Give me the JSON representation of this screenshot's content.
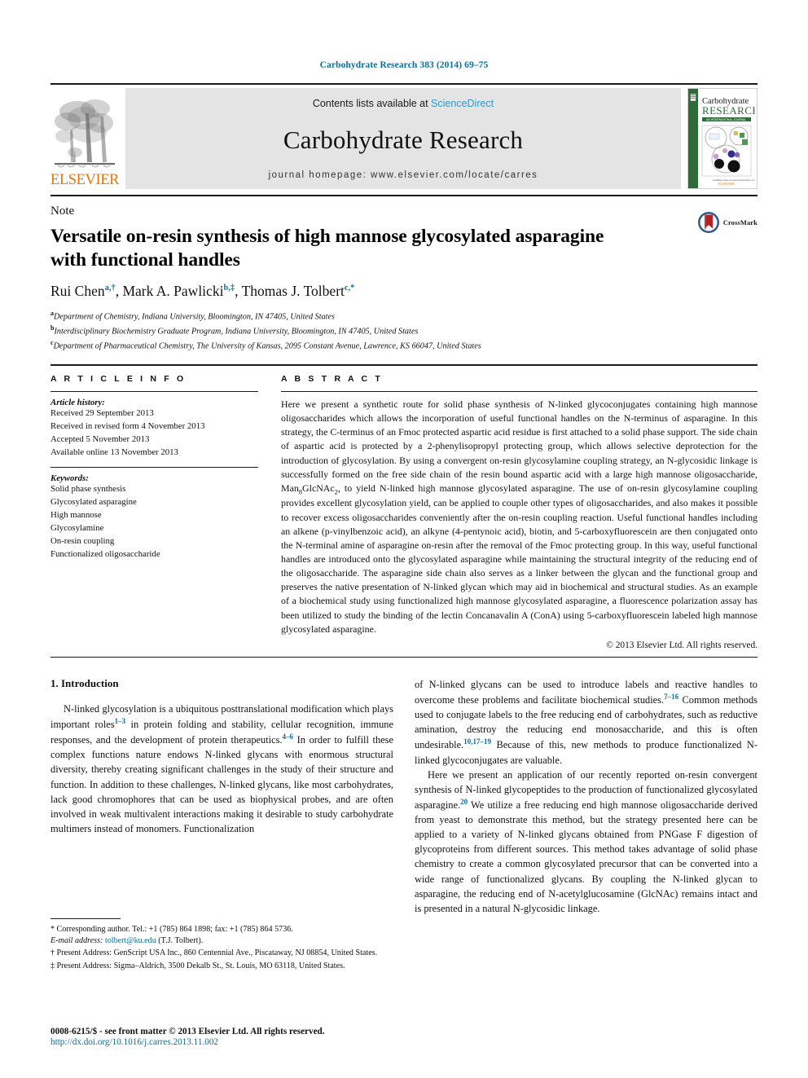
{
  "running_head": "Carbohydrate Research 383 (2014) 69–75",
  "masthead": {
    "publisher_logo_word": "ELSEVIER",
    "contents_prefix": "Contents lists available at ",
    "contents_link": "ScienceDirect",
    "journal_title": "Carbohydrate Research",
    "homepage": "journal homepage: www.elsevier.com/locate/carres",
    "cover": {
      "title_line1": "Carbohydrate",
      "title_line2": "RESEARCH",
      "subtitle": "AN INTERNATIONAL JOURNAL",
      "footer": "ELSEVIER"
    }
  },
  "article": {
    "doc_type": "Note",
    "title": "Versatile on-resin synthesis of high mannose glycosylated asparagine with functional handles",
    "crossmark_label": "CrossMark",
    "authors": [
      {
        "name": "Rui Chen",
        "marks": "a,†"
      },
      {
        "name": "Mark A. Pawlicki",
        "marks": "b,‡"
      },
      {
        "name": "Thomas J. Tolbert",
        "marks": "c,*"
      }
    ],
    "affiliations": [
      {
        "mark": "a",
        "text": "Department of Chemistry, Indiana University, Bloomington, IN 47405, United States"
      },
      {
        "mark": "b",
        "text": "Interdisciplinary Biochemistry Graduate Program, Indiana University, Bloomington, IN 47405, United States"
      },
      {
        "mark": "c",
        "text": "Department of Pharmaceutical Chemistry, The University of Kansas, 2095 Constant Avenue, Lawrence, KS 66047, United States"
      }
    ]
  },
  "article_info": {
    "section_label": "A R T I C L E   I N F O",
    "history_label": "Article history:",
    "history": [
      "Received 29 September 2013",
      "Received in revised form 4 November 2013",
      "Accepted 5 November 2013",
      "Available online 13 November 2013"
    ],
    "keywords_label": "Keywords:",
    "keywords": [
      "Solid phase synthesis",
      "Glycosylated asparagine",
      "High mannose",
      "Glycosylamine",
      "On-resin coupling",
      "Functionalized oligosaccharide"
    ]
  },
  "abstract": {
    "section_label": "A B S T R A C T",
    "part1": "Here we present a synthetic route for solid phase synthesis of N-linked glycoconjugates containing high mannose oligosaccharides which allows the incorporation of useful functional handles on the N-terminus of asparagine. In this strategy, the C-terminus of an Fmoc protected aspartic acid residue is first attached to a solid phase support. The side chain of aspartic acid is protected by a 2-phenylisopropyl protecting group, which allows selective deprotection for the introduction of glycosylation. By using a convergent on-resin glycosylamine coupling strategy, an N-glycosidic linkage is successfully formed on the free side chain of the resin bound aspartic acid with a large high mannose oligosaccharide, Man",
    "sub1": "8",
    "part2": "GlcNAc",
    "sub2": "2",
    "part3": ", to yield N-linked high mannose glycosylated asparagine. The use of on-resin glycosylamine coupling provides excellent glycosylation yield, can be applied to couple other types of oligosaccharides, and also makes it possible to recover excess oligosaccharides conveniently after the on-resin coupling reaction. Useful functional handles including an alkene (p-vinylbenzoic acid), an alkyne (4-pentynoic acid), biotin, and 5-carboxyfluorescein are then conjugated onto the N-terminal amine of asparagine on-resin after the removal of the Fmoc protecting group. In this way, useful functional handles are introduced onto the glycosylated asparagine while maintaining the structural integrity of the reducing end of the oligosaccharide. The asparagine side chain also serves as a linker between the glycan and the functional group and preserves the native presentation of N-linked glycan which may aid in biochemical and structural studies. As an example of a biochemical study using functionalized high mannose glycosylated asparagine, a fluorescence polarization assay has been utilized to study the binding of the lectin Concanavalin A (ConA) using 5-carboxyfluorescein labeled high mannose glycosylated asparagine.",
    "copyright": "© 2013 Elsevier Ltd. All rights reserved."
  },
  "body": {
    "section_heading": "1. Introduction",
    "left_para1_a": "N-linked glycosylation is a ubiquitous posttranslational modification which plays important roles",
    "left_ref1": "1–3",
    "left_para1_b": " in protein folding and stability, cellular recognition, immune responses, and the development of protein therapeutics.",
    "left_ref2": "4–6",
    "left_para1_c": " In order to fulfill these complex functions nature endows N-linked glycans with enormous structural diversity, thereby creating significant challenges in the study of their structure and function. In addition to these challenges, N-linked glycans, like most carbohydrates, lack good chromophores that can be used as biophysical probes, and are often involved in weak multivalent interactions making it desirable to study carbohydrate multimers instead of monomers. Functionalization",
    "right_para1_a": "of N-linked glycans can be used to introduce labels and reactive handles to overcome these problems and facilitate biochemical studies.",
    "right_ref1": "7–16",
    "right_para1_b": " Common methods used to conjugate labels to the free reducing end of carbohydrates, such as reductive amination, destroy the reducing end monosaccharide, and this is often undesirable.",
    "right_ref2": "10,17–19",
    "right_para1_c": " Because of this, new methods to produce functionalized N-linked glycoconjugates are valuable.",
    "right_para2_a": "Here we present an application of our recently reported on-resin convergent synthesis of N-linked glycopeptides to the production of functionalized glycosylated asparagine.",
    "right_ref3": "20",
    "right_para2_b": " We utilize a free reducing end high mannose oligosaccharide derived from yeast to demonstrate this method, but the strategy presented here can be applied to a variety of N-linked glycans obtained from PNGase F digestion of glycoproteins from different sources. This method takes advantage of solid phase chemistry to create a common glycosylated precursor that can be converted into a wide range of functionalized glycans. By coupling the N-linked glycan to asparagine, the reducing end of N-acetylglucosamine (GlcNAc) remains intact and is presented in a natural N-glycosidic linkage."
  },
  "footnotes": [
    {
      "mark": "*",
      "text": "Corresponding author. Tel.: +1 (785) 864 1898; fax: +1 (785) 864 5736.",
      "email_label": "E-mail address:",
      "email": "tolbert@ku.edu",
      "email_suffix": " (T.J. Tolbert)."
    },
    {
      "mark": "†",
      "text": "Present Address: GenScript USA Inc., 860 Centennial Ave., Piscataway, NJ 08854, United States."
    },
    {
      "mark": "‡",
      "text": "Present Address: Sigma–Aldrich, 3500 Dekalb St., St. Louis, MO 63118, United States."
    }
  ],
  "bottom": {
    "issn_line": "0008-6215/$ - see front matter © 2013 Elsevier Ltd. All rights reserved.",
    "doi_line": "http://dx.doi.org/10.1016/j.carres.2013.11.002"
  },
  "colors": {
    "link_blue": "#0b6f9d",
    "sciencedirect_blue": "#2e9bd0",
    "elsevier_orange": "#ec7404",
    "masthead_grey": "#e4e4e4",
    "cover_green": "#2f6b38",
    "crossmark_red": "#b32025"
  }
}
